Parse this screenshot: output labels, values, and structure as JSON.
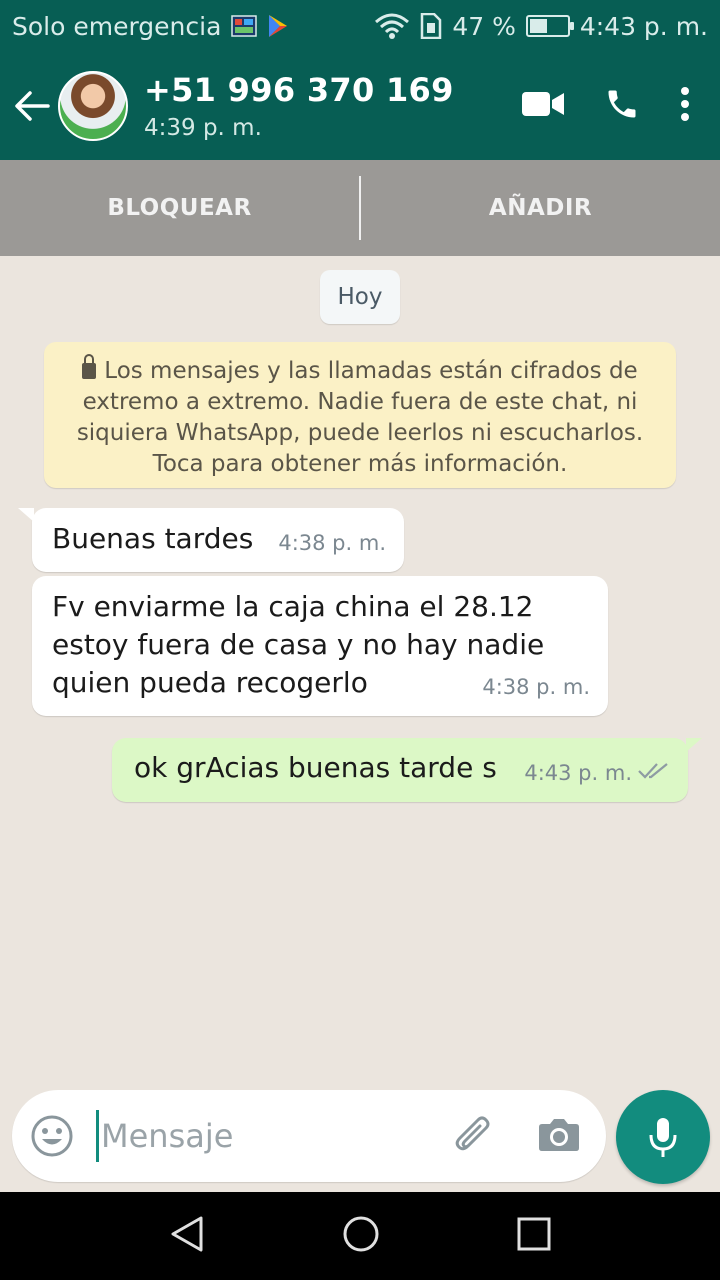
{
  "status_bar": {
    "carrier": "Solo emergencia",
    "battery_percent": "47 %",
    "battery_level": 0.47,
    "time": "4:43 p. m."
  },
  "app_bar": {
    "contact_name": "+51 996 370 169",
    "last_seen": "4:39 p. m."
  },
  "action_bar": {
    "block_label": "BLOQUEAR",
    "add_label": "AÑADIR"
  },
  "chat": {
    "date_chip": "Hoy",
    "encryption_notice": {
      "lines": [
        "Los mensajes y las llamadas están cifrados de",
        "extremo a extremo. Nadie fuera de este chat, ni",
        "siquiera WhatsApp, puede leerlos ni escucharlos.",
        "Toca para obtener más información."
      ]
    },
    "messages": [
      {
        "direction": "incoming",
        "lines": [
          "Buenas tardes"
        ],
        "time": "4:38 p. m."
      },
      {
        "direction": "incoming",
        "lines": [
          "Fv enviarme la caja china el 28.12",
          "estoy fuera de casa y no hay nadie",
          "quien pueda recogerlo"
        ],
        "time": "4:38 p. m."
      },
      {
        "direction": "outgoing",
        "lines": [
          "ok grAcias  buenas tarde s"
        ],
        "time": "4:43 p. m.",
        "status": "delivered"
      }
    ]
  },
  "composer": {
    "placeholder": "Mensaje"
  },
  "colors": {
    "primary": "#075e54",
    "accent": "#128c7e",
    "outgoing_bubble": "#dcf8c6",
    "notice_bg": "#fbf1c6"
  }
}
